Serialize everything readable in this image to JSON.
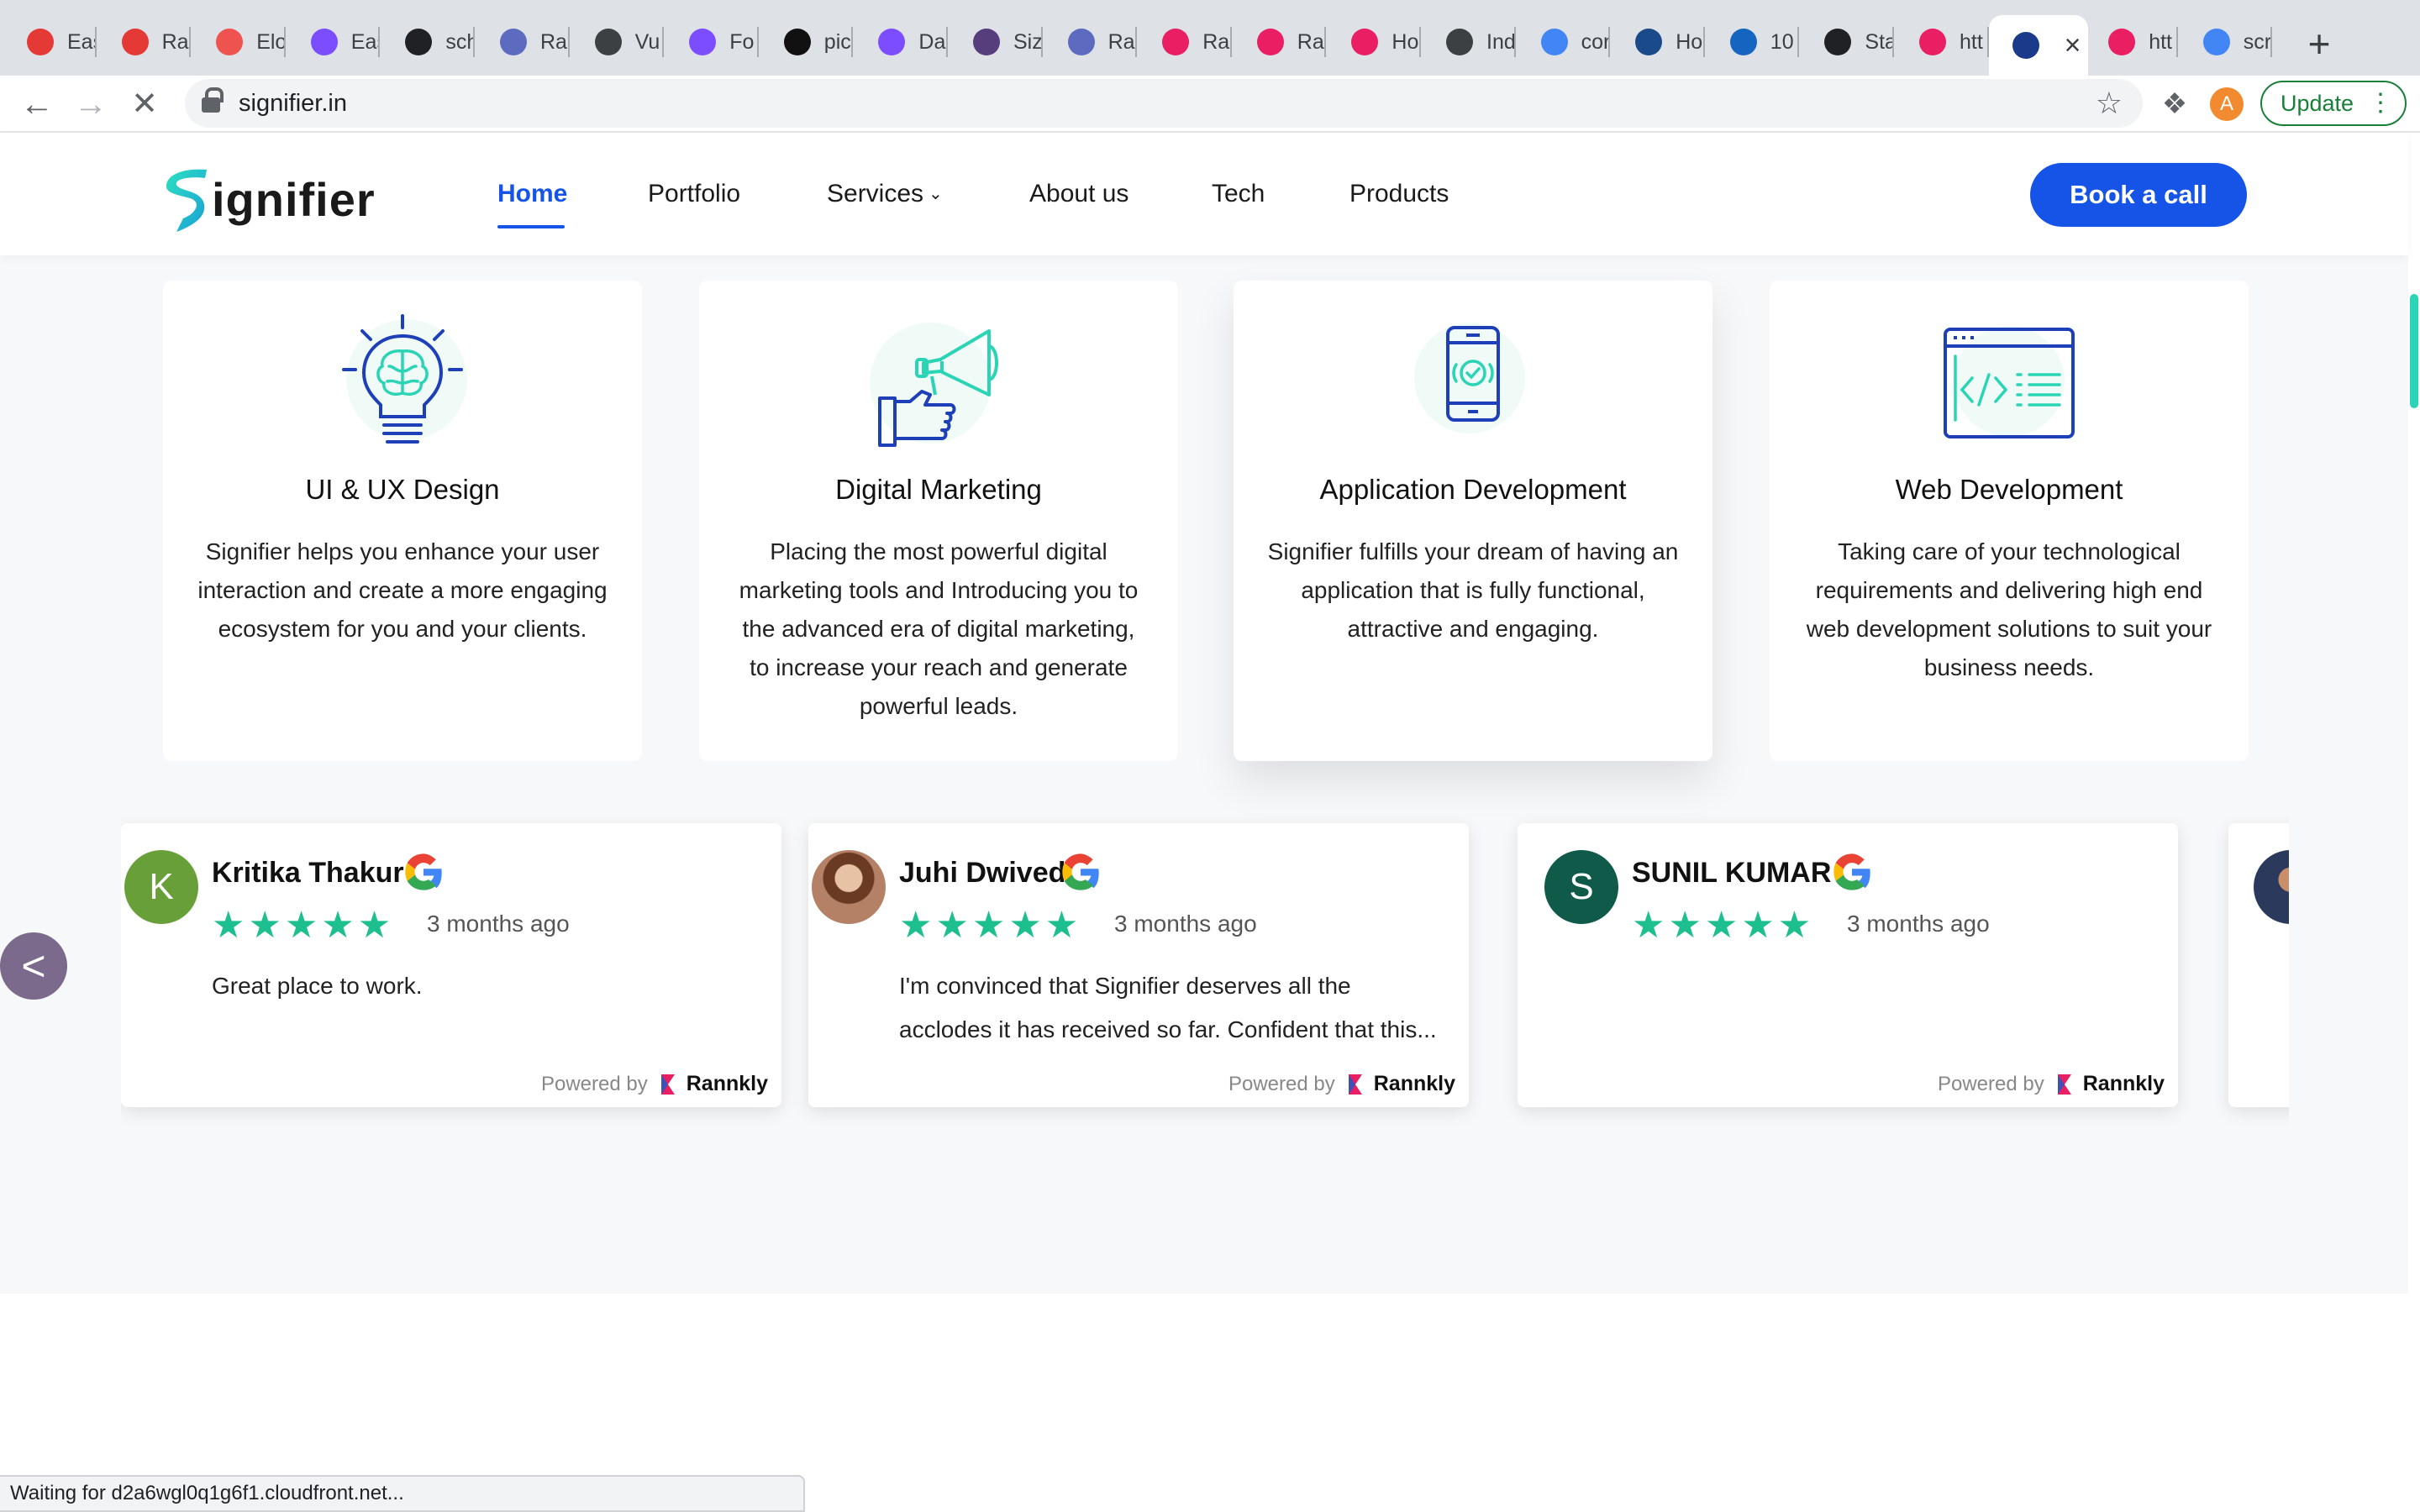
{
  "browser": {
    "tabs": [
      {
        "title": "Eas",
        "favicon_color": "#e53935",
        "icon": "globe-icon"
      },
      {
        "title": "Ral",
        "favicon_color": "#e53935",
        "icon": "globe-icon"
      },
      {
        "title": "Elo",
        "favicon_color": "#ef5350",
        "icon": "laravel-icon"
      },
      {
        "title": "Eas",
        "favicon_color": "#7c4dff",
        "icon": "heart-icon"
      },
      {
        "title": "sch",
        "favicon_color": "#202124",
        "icon": "github-icon"
      },
      {
        "title": "Ral",
        "favicon_color": "#5c6bc0",
        "icon": "chart-icon"
      },
      {
        "title": "Vu",
        "favicon_color": "#3c4043",
        "icon": "globe-icon"
      },
      {
        "title": "Fo",
        "favicon_color": "#7c4dff",
        "icon": "heart-icon"
      },
      {
        "title": "pic",
        "favicon_color": "#111111",
        "icon": "p-icon"
      },
      {
        "title": "Da",
        "favicon_color": "#7c4dff",
        "icon": "heart-icon"
      },
      {
        "title": "Siz",
        "favicon_color": "#563d7c",
        "icon": "bootstrap-icon"
      },
      {
        "title": "Ral",
        "favicon_color": "#5c6bc0",
        "icon": "chart-icon"
      },
      {
        "title": "Ra",
        "favicon_color": "#e91e63",
        "icon": "rannkly-icon"
      },
      {
        "title": "Ra",
        "favicon_color": "#e91e63",
        "icon": "rannkly-icon"
      },
      {
        "title": "Ho",
        "favicon_color": "#e91e63",
        "icon": "rannkly-icon"
      },
      {
        "title": "Ind",
        "favicon_color": "#3c4043",
        "icon": "globe-icon"
      },
      {
        "title": "cor",
        "favicon_color": "#4285f4",
        "icon": "google-icon"
      },
      {
        "title": "Ho",
        "favicon_color": "#1a4a8a",
        "icon": "castle-icon"
      },
      {
        "title": "10",
        "favicon_color": "#1565c0",
        "icon": "info-icon"
      },
      {
        "title": "Sta",
        "favicon_color": "#202124",
        "icon": "curve-icon"
      },
      {
        "title": "htt",
        "favicon_color": "#e91e63",
        "icon": "rannkly-icon"
      },
      {
        "title": "",
        "favicon_color": "#1a3a8a",
        "icon": "loading-icon",
        "active": true
      },
      {
        "title": "htt",
        "favicon_color": "#e91e63",
        "icon": "rannkly-icon"
      },
      {
        "title": "scr",
        "favicon_color": "#4285f4",
        "icon": "dot-icon"
      }
    ],
    "new_tab": "+",
    "url": "signifier.in",
    "profile_initial": "A",
    "update_label": "Update",
    "status_text": "Waiting for d2a6wgl0q1g6f1.cloudfront.net..."
  },
  "site": {
    "logo_text": "ignifier",
    "nav": [
      {
        "label": "Home",
        "active": true
      },
      {
        "label": "Portfolio"
      },
      {
        "label": "Services",
        "has_dropdown": true
      },
      {
        "label": "About us"
      },
      {
        "label": "Tech"
      },
      {
        "label": "Products"
      }
    ],
    "cta": "Book a call",
    "colors": {
      "brand_blue": "#1554e6",
      "brand_teal": "#2ad4b4",
      "star_green": "#1dbf8f"
    }
  },
  "services": [
    {
      "title": "UI & UX Design",
      "icon": "lightbulb-brain-icon",
      "desc": "Signifier helps you enhance your user interaction and create a more engaging ecosystem for you and your clients."
    },
    {
      "title": "Digital Marketing",
      "icon": "megaphone-icon",
      "desc": "Placing the most powerful digital marketing tools and Introducing you to the advanced era of digital marketing, to increase your reach and generate powerful leads."
    },
    {
      "title": "Application Development",
      "icon": "smartphone-icon",
      "desc": "Signifier fulfills your dream of having an application that is fully functional, attractive and engaging."
    },
    {
      "title": "Web Development",
      "icon": "code-window-icon",
      "desc": "Taking care of your technological requirements and delivering high end web development solutions to suit your business needs."
    }
  ],
  "reviews": [
    {
      "name": "Kritika Thakur",
      "initial": "K",
      "avatar_color": "#689f38",
      "stars": 5,
      "age": "3 months ago",
      "text": "Great place to work.",
      "powered_by": "Powered by",
      "brand": "Rannkly"
    },
    {
      "name": "Juhi Dwivedi",
      "initial": "",
      "avatar_color": "#a0664a",
      "stars": 5,
      "age": "3 months ago",
      "text": "I'm convinced that Signifier deserves all the acclodes it has received so far. Confident that this...",
      "powered_by": "Powered by",
      "brand": "Rannkly"
    },
    {
      "name": "SUNIL KUMAR",
      "initial": "S",
      "avatar_color": "#0f5a48",
      "stars": 5,
      "age": "3 months ago",
      "text": "",
      "powered_by": "Powered by",
      "brand": "Rannkly"
    }
  ],
  "carousel": {
    "prev_label": "<"
  }
}
